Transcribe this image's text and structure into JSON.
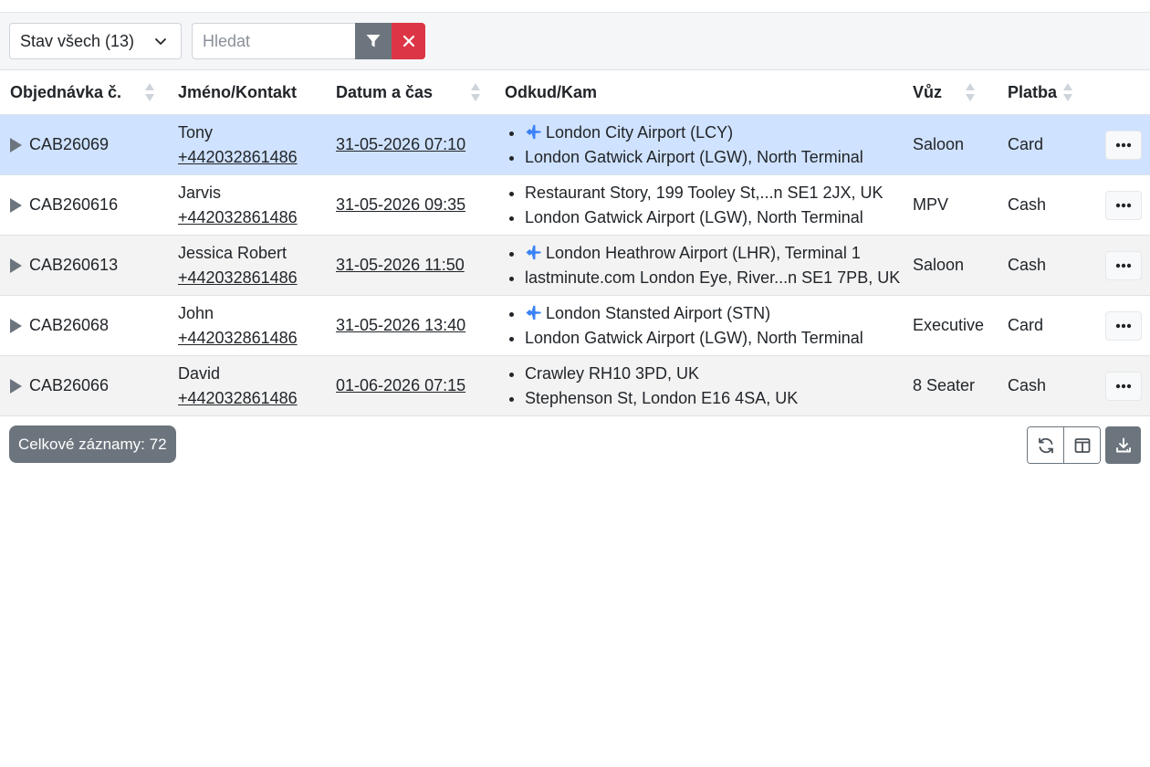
{
  "toolbar": {
    "status_label": "Stav všech (13)",
    "search_placeholder": "Hledat"
  },
  "table": {
    "columns": [
      "Objednávka č.",
      "Jméno/Kontakt",
      "Datum a čas",
      "Odkud/Kam",
      "Vůz",
      "Platba"
    ],
    "rows": [
      {
        "order": "CAB26069",
        "name": "Tony",
        "phone": "+442032861486",
        "datetime": "31-05-2026 07:10",
        "from": "London City Airport (LCY)",
        "from_airport": true,
        "to": "London Gatwick Airport (LGW), North Terminal",
        "to_airport": false,
        "vehicle": "Saloon",
        "payment": "Card",
        "selected": true
      },
      {
        "order": "CAB260616",
        "name": "Jarvis",
        "phone": "+442032861486",
        "datetime": "31-05-2026 09:35",
        "from": "Restaurant Story, 199 Tooley St,...n SE1 2JX, UK",
        "from_airport": false,
        "to": "London Gatwick Airport (LGW), North Terminal",
        "to_airport": false,
        "vehicle": "MPV",
        "payment": "Cash",
        "selected": false
      },
      {
        "order": "CAB260613",
        "name": "Jessica Robert",
        "phone": "+442032861486",
        "datetime": "31-05-2026 11:50",
        "from": "London Heathrow Airport (LHR), Terminal 1",
        "from_airport": true,
        "to": "lastminute.com London Eye, River...n SE1 7PB, UK",
        "to_airport": false,
        "vehicle": "Saloon",
        "payment": "Cash",
        "selected": false
      },
      {
        "order": "CAB26068",
        "name": "John",
        "phone": "+442032861486",
        "datetime": "31-05-2026 13:40",
        "from": "London Stansted Airport (STN)",
        "from_airport": true,
        "to": "London Gatwick Airport (LGW), North Terminal",
        "to_airport": false,
        "vehicle": "Executive",
        "payment": "Card",
        "selected": false
      },
      {
        "order": "CAB26066",
        "name": "David",
        "phone": "+442032861486",
        "datetime": "01-06-2026 07:15",
        "from": "Crawley RH10 3PD, UK",
        "from_airport": false,
        "to": "Stephenson St, London E16 4SA, UK",
        "to_airport": false,
        "vehicle": "8 Seater",
        "payment": "Cash",
        "selected": false
      }
    ]
  },
  "footer": {
    "total_label": "Celkové záznamy: 72"
  },
  "colors": {
    "selected_row": "#cfe2ff",
    "plane_icon": "#3b82f6",
    "filter_button": "#6c757d",
    "clear_button": "#dc3545"
  }
}
